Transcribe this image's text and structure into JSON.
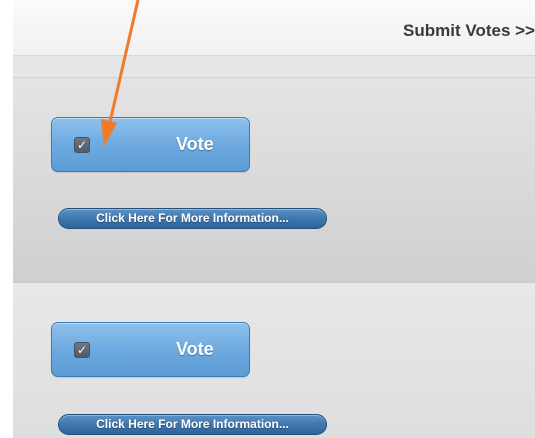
{
  "header": {
    "submit_label": "Submit Votes >>"
  },
  "entries": [
    {
      "vote_label": "Vote",
      "vote_checked": true,
      "checkbox_glyph": "✓",
      "info_label": "Click Here For More Information..."
    },
    {
      "vote_label": "Vote",
      "vote_checked": true,
      "checkbox_glyph": "✓",
      "info_label": "Click Here For More Information..."
    }
  ],
  "annotation": {
    "type": "arrow",
    "color": "#f07c2a",
    "points_to": "entries.0.checkbox"
  },
  "colors": {
    "vote_button": "#6eaadf",
    "info_button": "#3f77ad",
    "background": "#dcdcdc"
  }
}
